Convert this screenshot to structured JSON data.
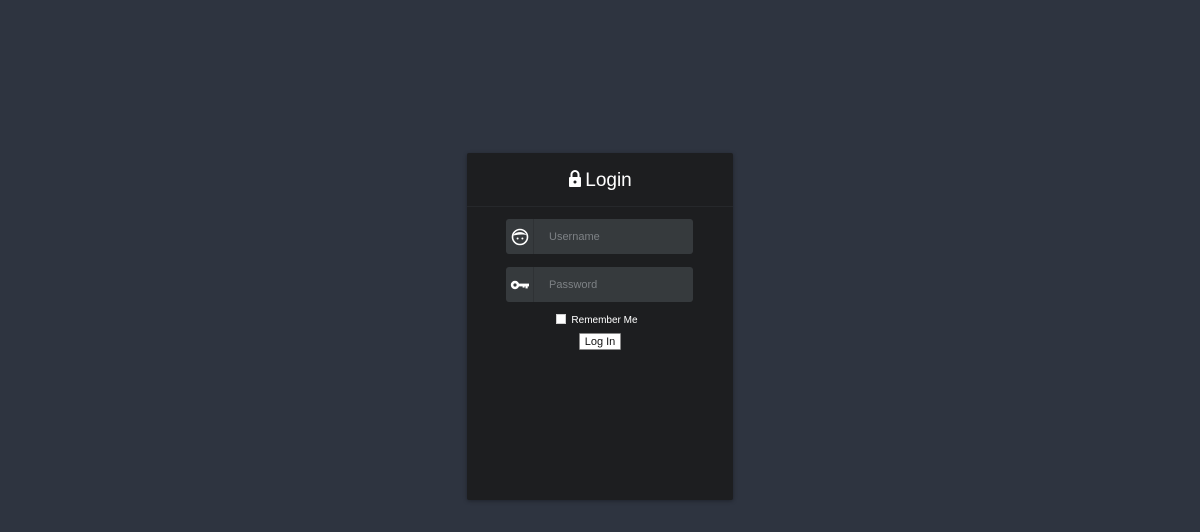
{
  "login": {
    "title": "Login",
    "username": {
      "placeholder": "Username",
      "value": "",
      "icon": "user-face-icon"
    },
    "password": {
      "placeholder": "Password",
      "value": "",
      "icon": "key-icon"
    },
    "remember_label": "Remember Me",
    "remember_checked": false,
    "submit_label": "Log In"
  },
  "colors": {
    "page_background": "#2e3440",
    "card_background": "#1d1e20",
    "field_background": "#363a3d",
    "placeholder": "#7d8185",
    "text": "#ffffff"
  }
}
